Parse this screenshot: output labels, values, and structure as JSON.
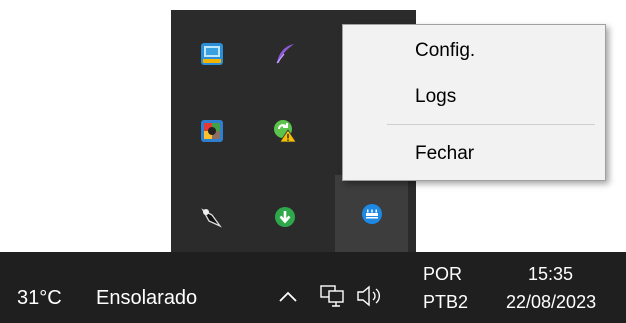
{
  "tray_flyout": {
    "icons": [
      {
        "name": "monitor-app-icon"
      },
      {
        "name": "feather-icon"
      },
      {
        "name": "puzzle-app-icon"
      },
      {
        "name": "sync-warning-icon"
      },
      {
        "name": "speaker-icon"
      },
      {
        "name": "download-circle-icon"
      },
      {
        "name": "server-status-icon"
      }
    ]
  },
  "context_menu": {
    "items": [
      {
        "label": "Config."
      },
      {
        "label": "Logs"
      },
      {
        "label": "Fechar"
      }
    ]
  },
  "taskbar": {
    "weather": {
      "temperature": "31°C",
      "condition": "Ensolarado"
    },
    "language": {
      "line1": "POR",
      "line2": "PTB2"
    },
    "clock": {
      "time": "15:35",
      "date": "22/08/2023"
    }
  }
}
